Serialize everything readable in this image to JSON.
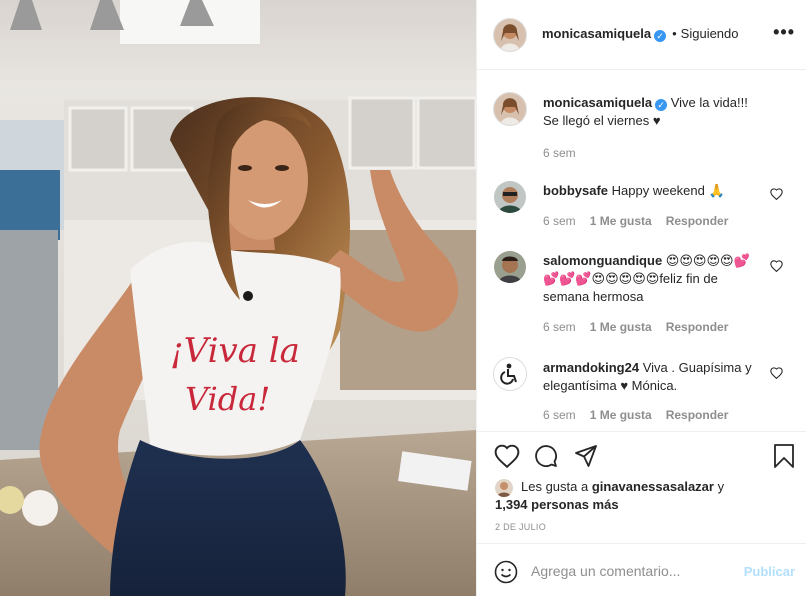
{
  "post": {
    "username": "monicasamiquela",
    "verified": true,
    "separator": "•",
    "follow_state": "Siguiendo",
    "more": "•••"
  },
  "photo": {
    "shirt_text_line1": "¡Viva la",
    "shirt_text_line2": "Vida!"
  },
  "caption": {
    "username": "monicasamiquela",
    "text": "Vive la vida!!! Se llegó el viernes ♥",
    "time": "6 sem"
  },
  "comments": [
    {
      "username": "bobbysafe",
      "text": "Happy weekend 🙏",
      "time": "6 sem",
      "likes": "1 Me gusta",
      "reply": "Responder"
    },
    {
      "username": "salomonguandique",
      "text": "😍😍😍😍😍💕💕💕💕😍😍😍😍😍feliz fin de semana hermosa",
      "time": "6 sem",
      "likes": "1 Me gusta",
      "reply": "Responder"
    },
    {
      "username": "armandoking24",
      "text": "Viva . Guapísima y elegantísima ♥ Mónica.",
      "time": "6 sem",
      "likes": "1 Me gusta",
      "reply": "Responder"
    }
  ],
  "likes": {
    "prefix": "Les gusta a ",
    "user": "ginavanessasalazar",
    "suffix": " y",
    "others": "1,394 personas más"
  },
  "date": "2 DE JULIO",
  "composer": {
    "placeholder": "Agrega un comentario...",
    "post_label": "Publicar"
  },
  "icons": {
    "like": "heart-icon",
    "comment": "comment-icon",
    "share": "paper-plane-icon",
    "save": "bookmark-icon",
    "emoji": "smiley-icon",
    "verified": "verified-badge-icon"
  },
  "colors": {
    "verified_blue": "#3897f0",
    "muted_text": "#8e8e8e",
    "post_button_disabled": "#b2dffc",
    "shirt_text_red": "#c8283a"
  }
}
